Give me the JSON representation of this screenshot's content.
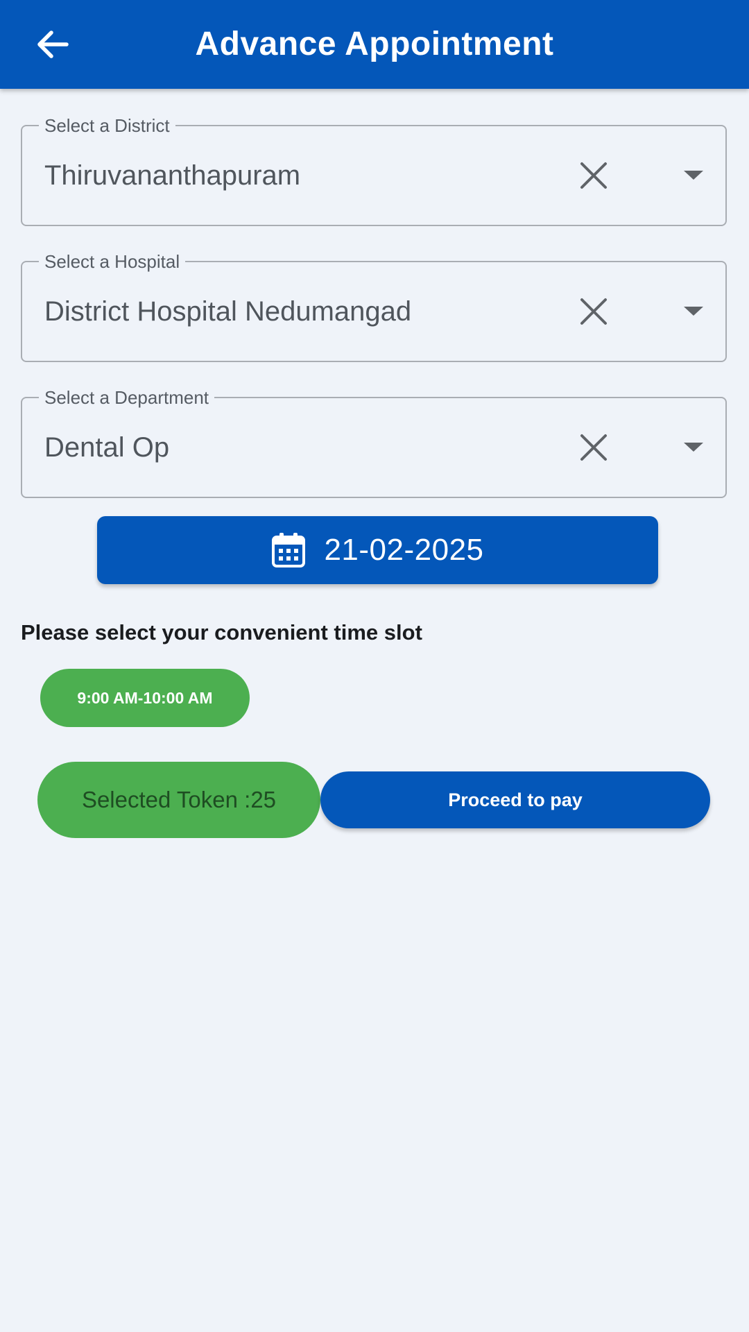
{
  "appbar": {
    "title": "Advance Appointment",
    "back_icon": "arrow-left-icon",
    "color": "#0457b9"
  },
  "form": {
    "district": {
      "label": "Select a District",
      "value": "Thiruvananthapuram"
    },
    "hospital": {
      "label": "Select a Hospital",
      "value": "District Hospital Nedumangad"
    },
    "department": {
      "label": "Select a Department",
      "value": "Dental Op"
    },
    "clear_icon": "close-icon",
    "dropdown_icon": "caret-down-icon"
  },
  "date_picker": {
    "icon": "calendar-icon",
    "value": "21-02-2025"
  },
  "time_slots": {
    "heading": "Please select your convenient time slot",
    "slots": [
      {
        "label": "9:00 AM-10:00 AM"
      }
    ],
    "color": "#4caf50"
  },
  "token": {
    "label": "Selected Token :25"
  },
  "actions": {
    "pay_label": "Proceed to pay"
  }
}
